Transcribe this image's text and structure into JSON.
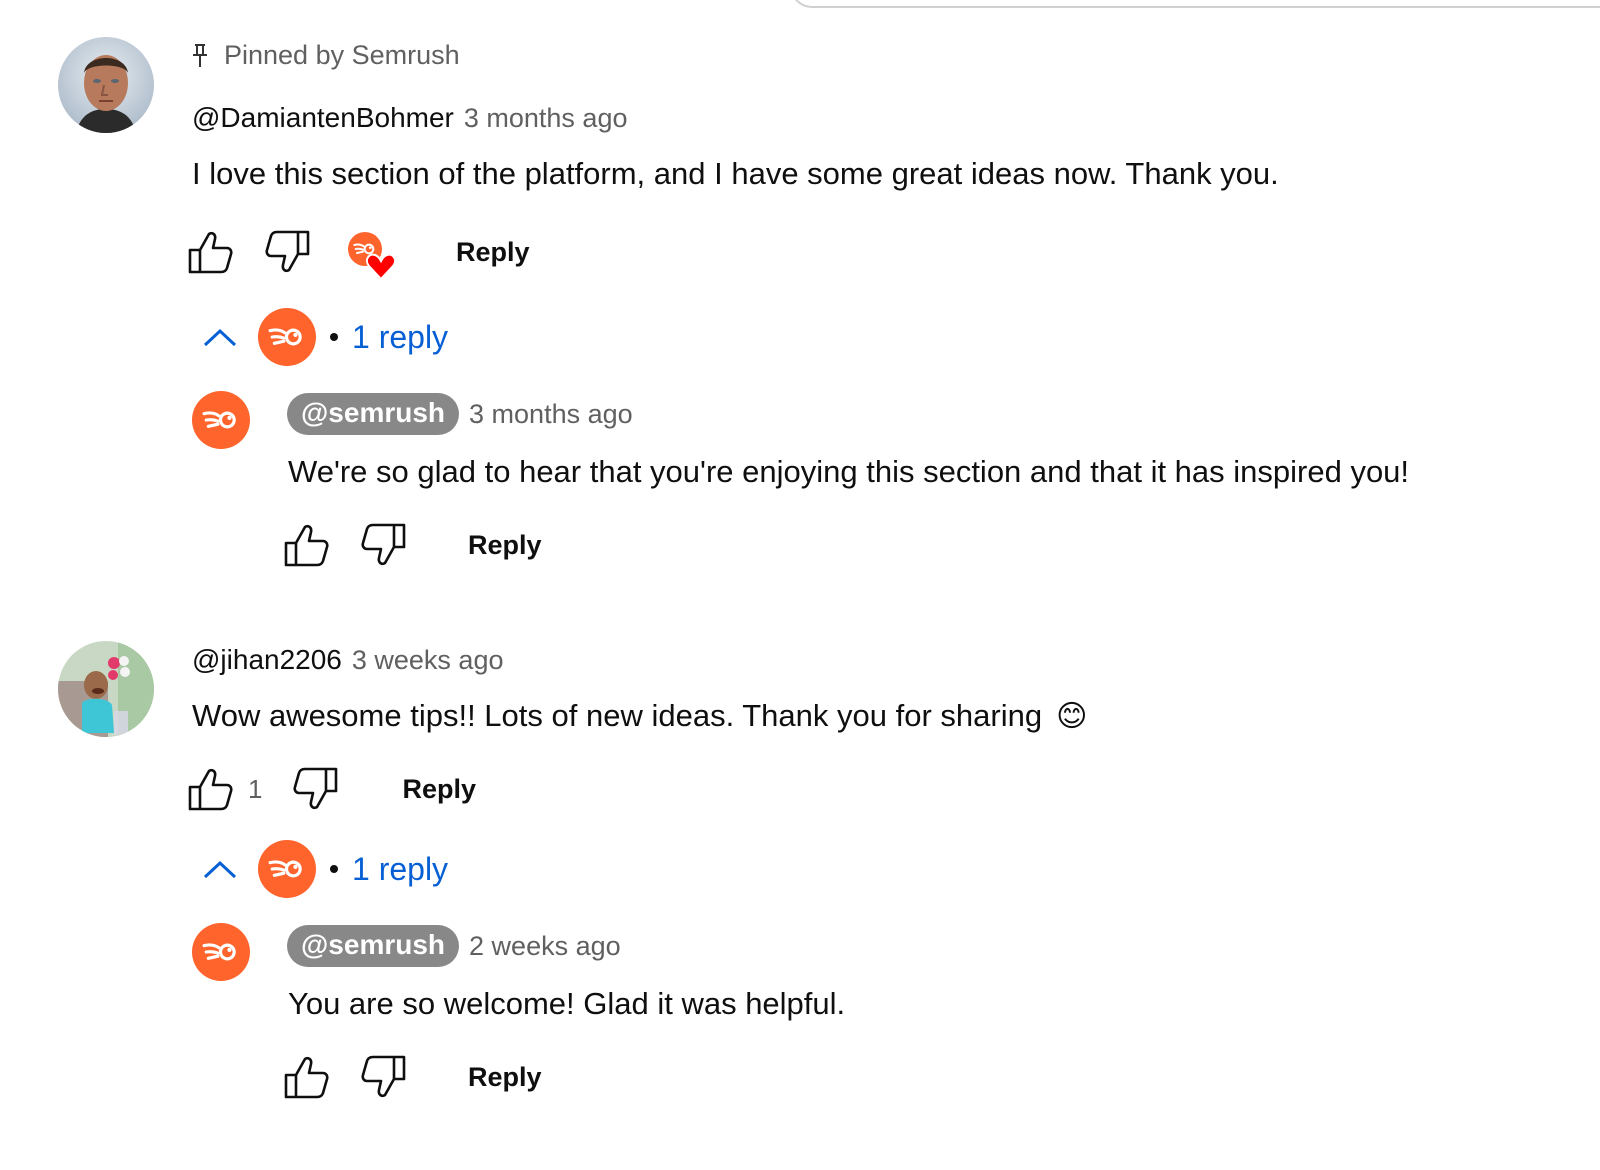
{
  "comments": [
    {
      "pinned_label": "Pinned by Semrush",
      "author": "@DamiantenBohmer",
      "time": "3 months ago",
      "text": "I love this section of the platform, and I have some great ideas now. Thank you.",
      "likes": "",
      "creator_heart": true,
      "reply_label": "Reply",
      "replies_toggle": "1 reply",
      "replies": [
        {
          "author": "@semrush",
          "time": "3 months ago",
          "text": "We're so glad to hear that you're enjoying this section and that it has inspired you!",
          "reply_label": "Reply"
        }
      ]
    },
    {
      "author": "@jihan2206",
      "time": "3 weeks ago",
      "text": "Wow awesome tips!! Lots of new ideas. Thank you for sharing",
      "emoji": "😊",
      "likes": "1",
      "reply_label": "Reply",
      "replies_toggle": "1 reply",
      "replies": [
        {
          "author": "@semrush",
          "time": "2 weeks ago",
          "text": "You are so welcome! Glad it was helpful.",
          "reply_label": "Reply"
        }
      ]
    }
  ],
  "colors": {
    "brand": "#ff642d",
    "link": "#065fd4",
    "heart": "#ff0000",
    "chip": "#888888"
  },
  "icons": {
    "like": "thumbs-up-icon",
    "dislike": "thumbs-down-icon",
    "pin": "pin-icon",
    "collapse": "chevron-up-icon",
    "heart": "heart-icon",
    "brand": "semrush-logo-icon"
  }
}
